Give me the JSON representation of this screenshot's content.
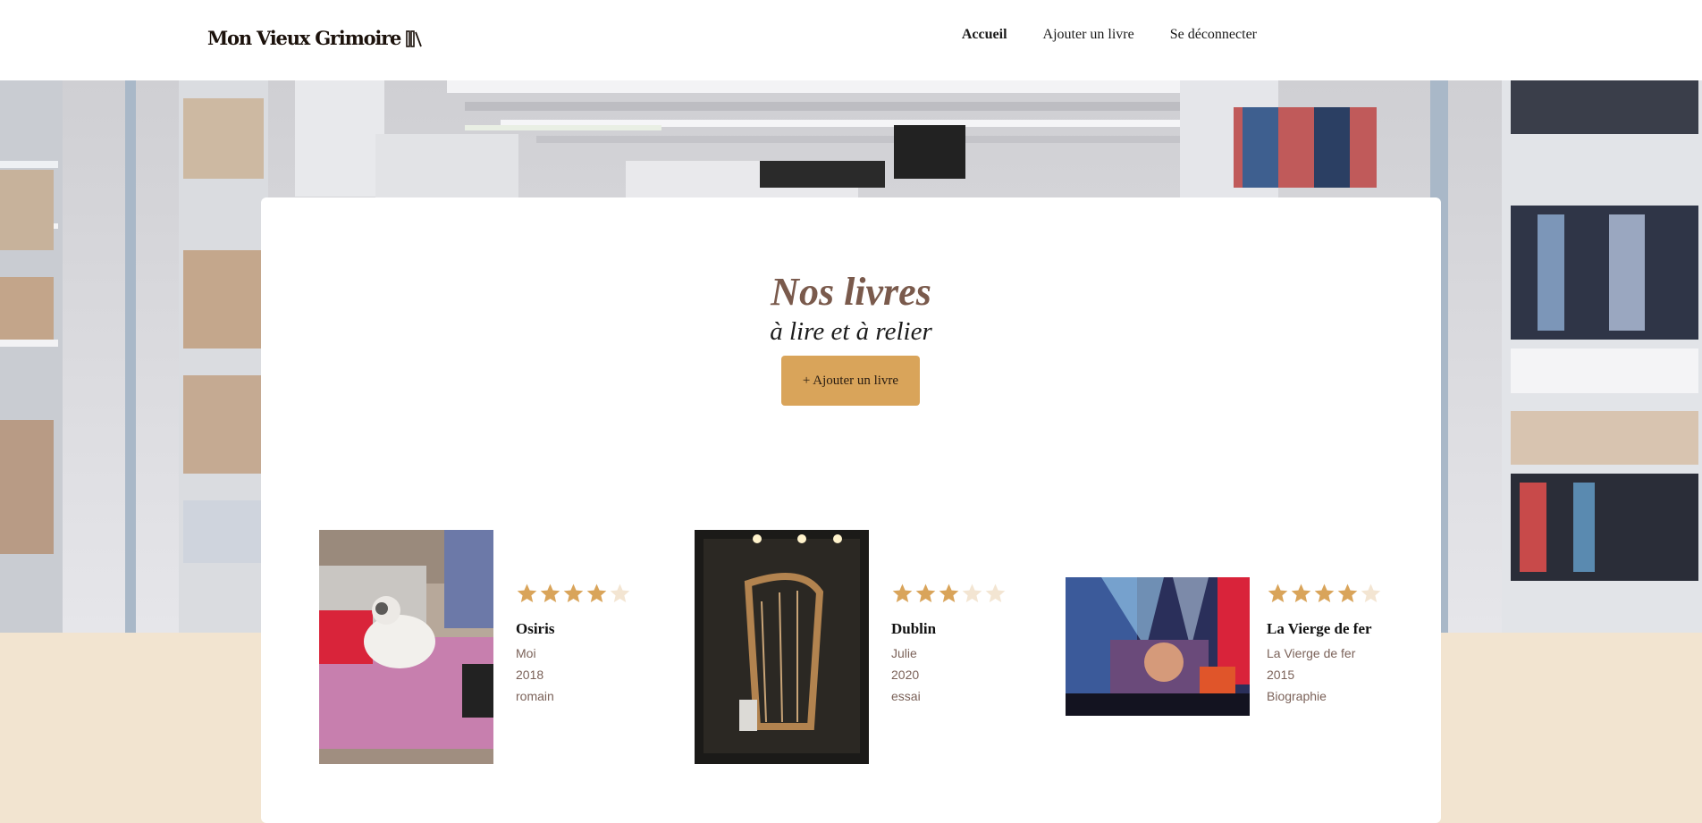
{
  "header": {
    "logo_text": "Mon Vieux Grimoire",
    "logo_icon": "books-icon",
    "nav": [
      {
        "label": "Accueil",
        "active": true
      },
      {
        "label": "Ajouter un livre",
        "active": false
      },
      {
        "label": "Se déconnecter",
        "active": false
      }
    ]
  },
  "main": {
    "title": "Nos livres",
    "subtitle": "à lire et à relier",
    "add_button_label": "+ Ajouter un livre"
  },
  "books": [
    {
      "title": "Osiris",
      "author": "Moi",
      "year": "2018",
      "genre": "romain",
      "rating": 4,
      "cover": "cat-photo"
    },
    {
      "title": "Dublin",
      "author": "Julie",
      "year": "2020",
      "genre": "essai",
      "rating": 3,
      "cover": "harp-photo"
    },
    {
      "title": "La Vierge de fer",
      "author": "La Vierge de fer",
      "year": "2015",
      "genre": "Biographie",
      "rating": 4,
      "cover": "concert-photo"
    }
  ],
  "colors": {
    "accent": "#d9a45a",
    "star_filled": "#d9a45a",
    "star_empty": "#f3e5d2",
    "title": "#7a5a4c",
    "background": "#f2e4d0"
  }
}
